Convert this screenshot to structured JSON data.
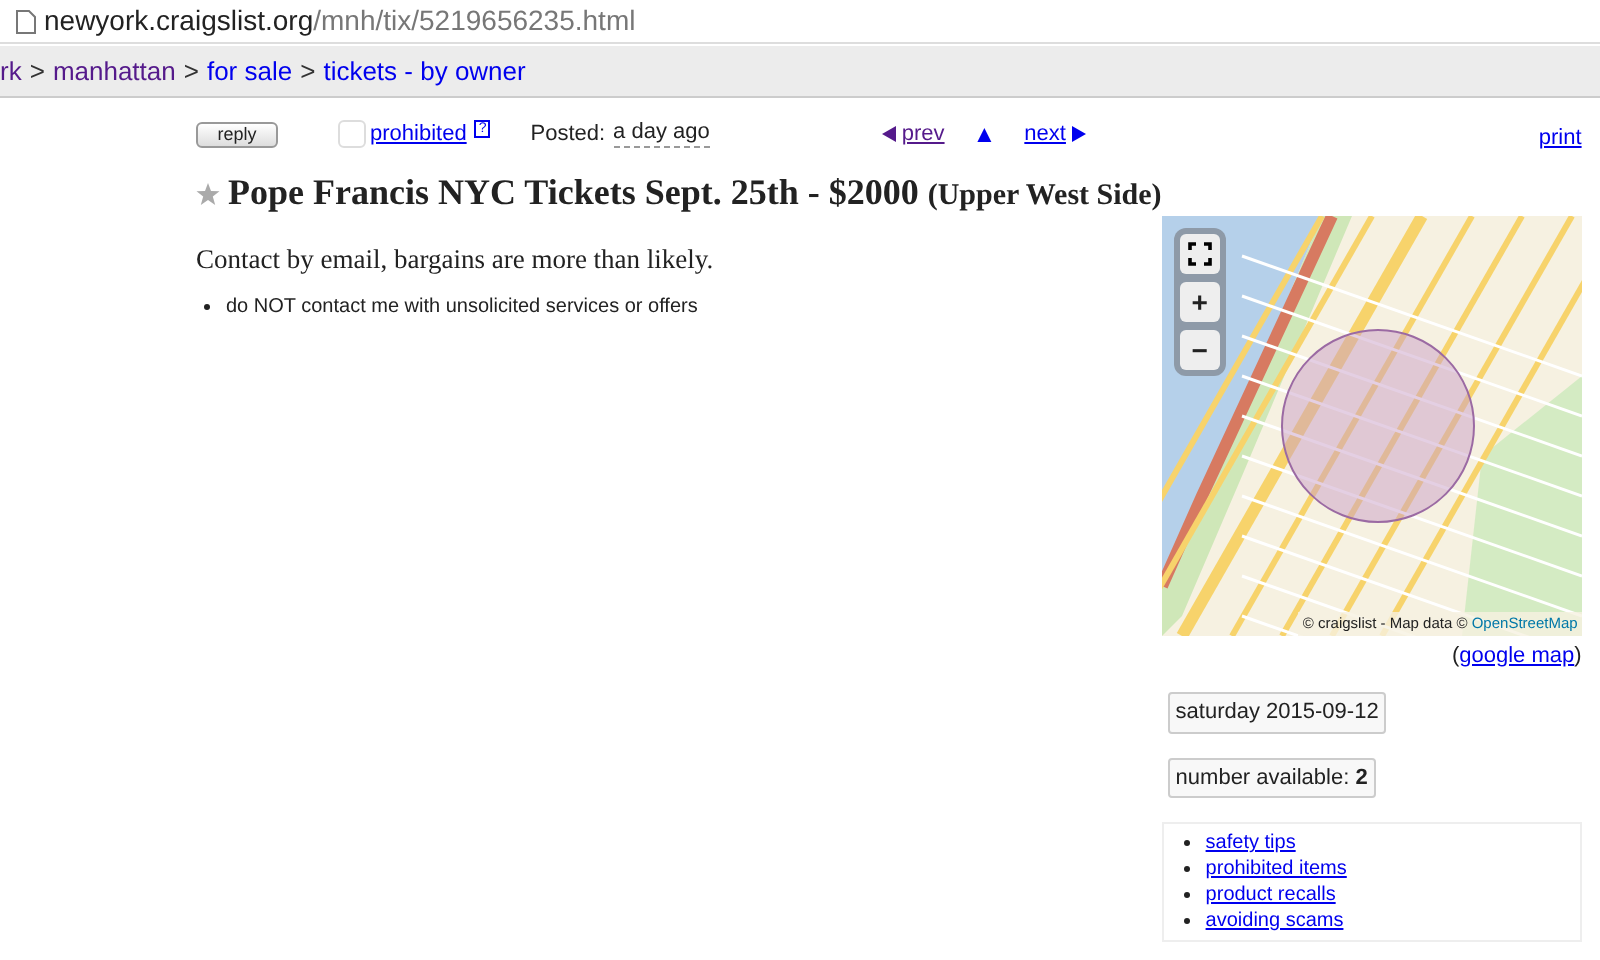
{
  "address_bar": {
    "host": "newyork.craigslist.org",
    "path": "/mnh/tix/5219656235.html"
  },
  "breadcrumbs": [
    {
      "label": "rk",
      "visited": true
    },
    {
      "label": "manhattan",
      "visited": true
    },
    {
      "label": "for sale",
      "visited": false
    },
    {
      "label": "tickets - by owner",
      "visited": false
    }
  ],
  "breadcrumb_separator": ">",
  "toolbar": {
    "reply": "reply",
    "prohibited": {
      "label": "prohibited",
      "checked": false,
      "help": "?"
    },
    "posted_label": "Posted:",
    "posted_time": "a day ago",
    "prev": "prev",
    "up": "▲",
    "next": "next",
    "print": "print"
  },
  "posting": {
    "title": "Pope Francis NYC Tickets Sept. 25th - $2000",
    "location": "(Upper West Side)",
    "favorite": false,
    "body": "Contact by email, bargains are more than likely.",
    "notices": [
      "do NOT contact me with unsolicited services or offers"
    ]
  },
  "map": {
    "controls": [
      {
        "kind": "fullscreen"
      },
      {
        "kind": "zoom_in",
        "label": "+"
      },
      {
        "kind": "zoom_out",
        "label": "−"
      }
    ],
    "attribution": "© craigslist - Map data ©",
    "attribution_link": "OpenStreetMap",
    "google_map_open": "(",
    "google_map": "google map",
    "google_map_close": ")"
  },
  "attributes": [
    {
      "text": "saturday 2015-09-12"
    },
    {
      "label": "number available:",
      "value": "2"
    }
  ],
  "help_links": [
    "safety tips",
    "prohibited items",
    "product recalls",
    "avoiding scams"
  ]
}
